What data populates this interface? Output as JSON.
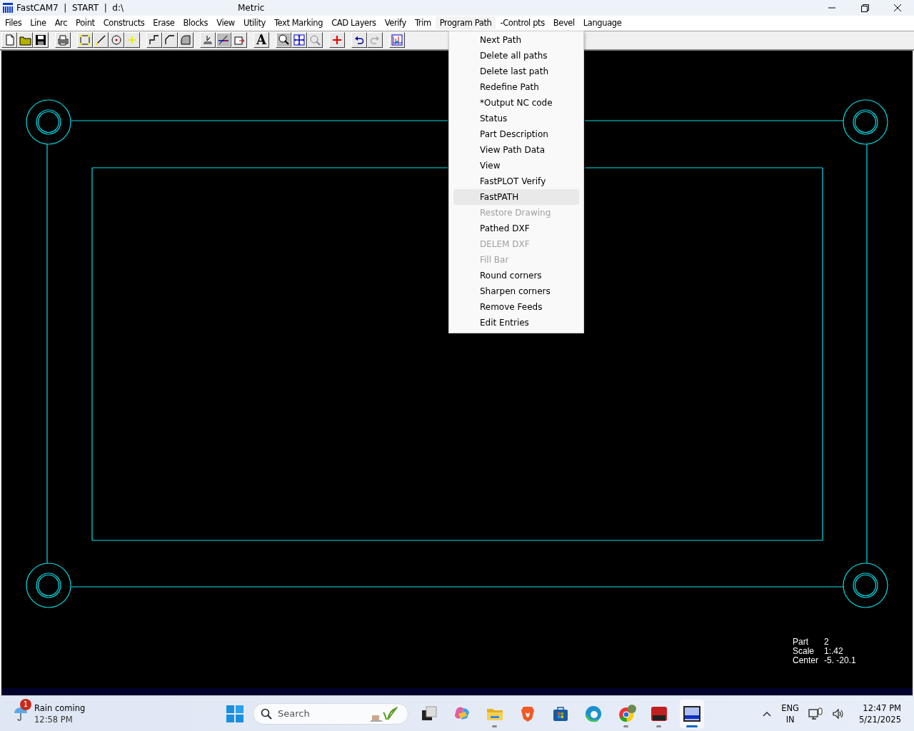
{
  "window": {
    "title": "FastCAM7  |  START  |  d:\\",
    "mode": "Metric"
  },
  "menu_bar": [
    {
      "label": "Files",
      "selected": false
    },
    {
      "label": "Line",
      "selected": false
    },
    {
      "label": "Arc",
      "selected": false
    },
    {
      "label": "Point",
      "selected": false
    },
    {
      "label": "Constructs",
      "selected": false
    },
    {
      "label": "Erase",
      "selected": false
    },
    {
      "label": "Blocks",
      "selected": false
    },
    {
      "label": "View",
      "selected": false
    },
    {
      "label": "Utility",
      "selected": false
    },
    {
      "label": "Text Marking",
      "selected": false
    },
    {
      "label": "CAD Layers",
      "selected": false
    },
    {
      "label": "Verify",
      "selected": false
    },
    {
      "label": "Trim",
      "selected": false
    },
    {
      "label": "Program Path",
      "selected": true
    },
    {
      "label": "-Control pts",
      "selected": false
    },
    {
      "label": "Bevel",
      "selected": false
    },
    {
      "label": "Language",
      "selected": false
    }
  ],
  "toolbar": {
    "text_button": "A"
  },
  "dropdown": [
    {
      "label": "Next Path",
      "disabled": false,
      "highlighted": false
    },
    {
      "label": "Delete all paths",
      "disabled": false,
      "highlighted": false
    },
    {
      "label": "Delete last path",
      "disabled": false,
      "highlighted": false
    },
    {
      "label": "Redefine Path",
      "disabled": false,
      "highlighted": false
    },
    {
      "label": "*Output NC code",
      "disabled": false,
      "highlighted": false
    },
    {
      "label": "Status",
      "disabled": false,
      "highlighted": false
    },
    {
      "label": "Part Description",
      "disabled": false,
      "highlighted": false
    },
    {
      "label": "View Path Data",
      "disabled": false,
      "highlighted": false
    },
    {
      "label": "View",
      "disabled": false,
      "highlighted": false
    },
    {
      "label": "FastPLOT Verify",
      "disabled": false,
      "highlighted": false
    },
    {
      "label": "FastPATH",
      "disabled": false,
      "highlighted": true
    },
    {
      "label": "Restore Drawing",
      "disabled": true,
      "highlighted": false
    },
    {
      "label": "Pathed DXF",
      "disabled": false,
      "highlighted": false
    },
    {
      "label": "DELEM DXF",
      "disabled": true,
      "highlighted": false
    },
    {
      "label": "Fill Bar",
      "disabled": true,
      "highlighted": false
    },
    {
      "label": "Round corners",
      "disabled": false,
      "highlighted": false
    },
    {
      "label": "Sharpen corners",
      "disabled": false,
      "highlighted": false
    },
    {
      "label": "Remove Feeds",
      "disabled": false,
      "highlighted": false
    },
    {
      "label": "Edit Entries",
      "disabled": false,
      "highlighted": false
    }
  ],
  "info": [
    {
      "label": "Part",
      "value": "2"
    },
    {
      "label": "Scale",
      "value": "1:.42"
    },
    {
      "label": "Center",
      "value": "-5. -20.1"
    }
  ],
  "taskbar": {
    "weather": {
      "badge": "1",
      "title": "Rain coming",
      "time": "12:58 PM"
    },
    "search": {
      "placeholder": "Search"
    },
    "apps": [
      {
        "kind": "taskview",
        "running": false,
        "active": false
      },
      {
        "kind": "copilot",
        "running": false,
        "active": false
      },
      {
        "kind": "explorer",
        "running": true,
        "active": false
      },
      {
        "kind": "brave",
        "running": false,
        "active": false
      },
      {
        "kind": "store",
        "running": false,
        "active": false
      },
      {
        "kind": "edge",
        "running": false,
        "active": false
      },
      {
        "kind": "chrome",
        "running": true,
        "active": false
      },
      {
        "kind": "cad",
        "running": true,
        "active": false
      },
      {
        "kind": "fastcam",
        "running": true,
        "active": true
      }
    ],
    "tray": {
      "language": "ENG",
      "region": "IN",
      "time": "12:47 PM",
      "date": "5/21/2025"
    }
  }
}
